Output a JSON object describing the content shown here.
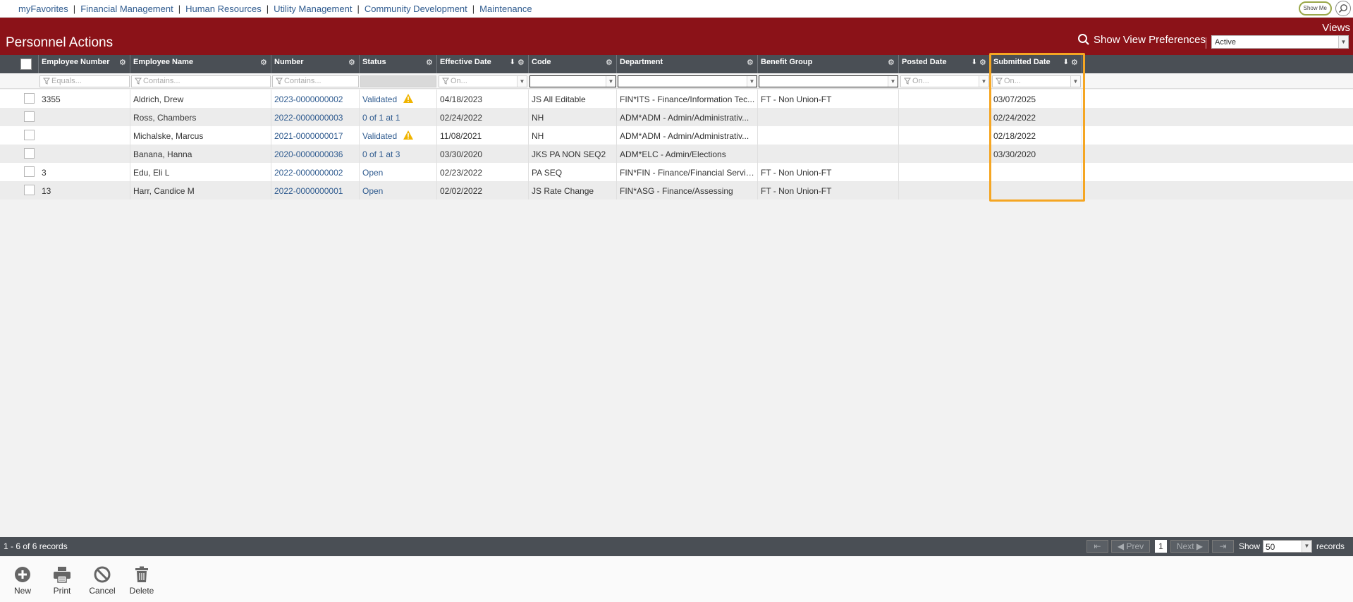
{
  "nav": {
    "items": [
      "myFavorites",
      "Financial Management",
      "Human Resources",
      "Utility Management",
      "Community Development",
      "Maintenance"
    ],
    "separator": "|",
    "show_me": "Show Me"
  },
  "header": {
    "title": "Personnel Actions",
    "views_label": "Views",
    "show_view_prefs": "Show View Preferences",
    "view_selected": "Active"
  },
  "columns": [
    "Employee Number",
    "Employee Name",
    "Number",
    "Status",
    "Effective Date",
    "Code",
    "Department",
    "Benefit Group",
    "Posted Date",
    "Submitted Date"
  ],
  "filters": {
    "employee_number": "Equals...",
    "employee_name": "Contains...",
    "number": "Contains...",
    "effective_date": "On...",
    "posted_date": "On...",
    "submitted_date": "On..."
  },
  "rows": [
    {
      "emp_no": "3355",
      "name": "Aldrich, Drew",
      "number": "2023-0000000002",
      "status": "Validated",
      "warning": true,
      "effective": "04/18/2023",
      "code": "JS All Editable",
      "dept": "FIN*ITS - Finance/Information Tec...",
      "benefit": "FT - Non Union-FT",
      "posted": "",
      "submitted": "03/07/2025"
    },
    {
      "emp_no": "",
      "name": "Ross, Chambers",
      "number": "2022-0000000003",
      "status": "0 of 1 at 1",
      "warning": false,
      "effective": "02/24/2022",
      "code": "NH",
      "dept": "ADM*ADM - Admin/Administrativ...",
      "benefit": "",
      "posted": "",
      "submitted": "02/24/2022"
    },
    {
      "emp_no": "",
      "name": "Michalske, Marcus",
      "number": "2021-0000000017",
      "status": "Validated",
      "warning": true,
      "effective": "11/08/2021",
      "code": "NH",
      "dept": "ADM*ADM - Admin/Administrativ...",
      "benefit": "",
      "posted": "",
      "submitted": "02/18/2022"
    },
    {
      "emp_no": "",
      "name": "Banana, Hanna",
      "number": "2020-0000000036",
      "status": "0 of 1 at 3",
      "warning": false,
      "effective": "03/30/2020",
      "code": "JKS PA NON SEQ2",
      "dept": "ADM*ELC - Admin/Elections",
      "benefit": "",
      "posted": "",
      "submitted": "03/30/2020"
    },
    {
      "emp_no": "3",
      "name": "Edu, Eli L",
      "number": "2022-0000000002",
      "status": "Open",
      "warning": false,
      "effective": "02/23/2022",
      "code": "PA SEQ",
      "dept": "FIN*FIN - Finance/Financial Services",
      "benefit": "FT - Non Union-FT",
      "posted": "",
      "submitted": ""
    },
    {
      "emp_no": "13",
      "name": "Harr, Candice M",
      "number": "2022-0000000001",
      "status": "Open",
      "warning": false,
      "effective": "02/02/2022",
      "code": "JS Rate Change",
      "dept": "FIN*ASG - Finance/Assessing",
      "benefit": "FT - Non Union-FT",
      "posted": "",
      "submitted": ""
    }
  ],
  "footer": {
    "record_count": "1 - 6 of 6 records",
    "prev": "Prev",
    "next": "Next",
    "page": "1",
    "show": "Show",
    "page_size": "50",
    "records": "records"
  },
  "toolbar": {
    "new": "New",
    "print": "Print",
    "cancel": "Cancel",
    "delete": "Delete"
  },
  "colors": {
    "header_band": "#8b1218",
    "grid_header": "#4a4f55",
    "link": "#2f5b8f",
    "highlight": "#f5a623",
    "warning": "#f0b400"
  }
}
